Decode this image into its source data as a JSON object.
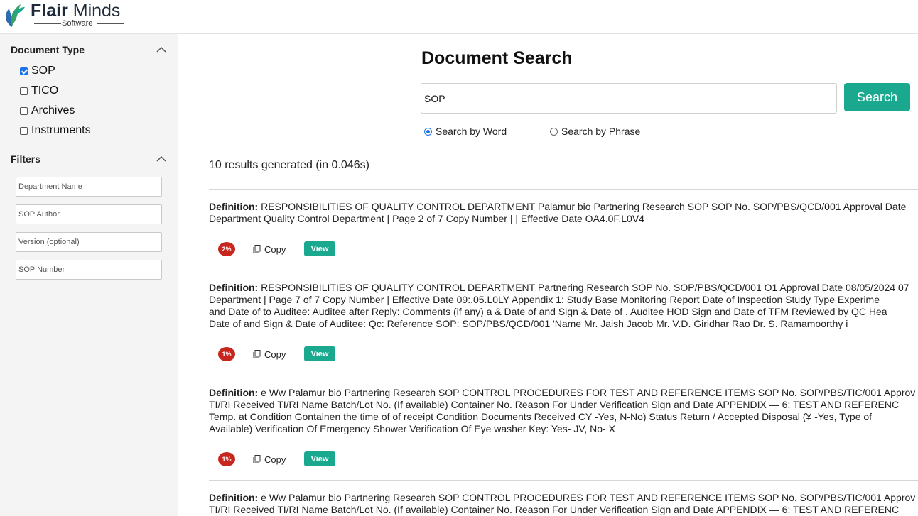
{
  "brand": {
    "name_bold": "Flair",
    "name_rest": " Minds",
    "sub": "Software"
  },
  "sidebar": {
    "document_type_title": "Document Type",
    "document_types": [
      {
        "label": "SOP",
        "checked": true
      },
      {
        "label": "TICO",
        "checked": false
      },
      {
        "label": "Archives",
        "checked": false
      },
      {
        "label": "Instruments",
        "checked": false
      }
    ],
    "filters_title": "Filters",
    "filters": [
      {
        "placeholder": "Department Name"
      },
      {
        "placeholder": "SOP Author"
      },
      {
        "placeholder": "Version (optional)"
      },
      {
        "placeholder": "SOP Number"
      }
    ]
  },
  "main": {
    "title": "Document Search",
    "search_value": "SOP",
    "search_button": "Search",
    "radio_word": "Search by Word",
    "radio_phrase": "Search by Phrase",
    "selected_mode": "word",
    "results_summary": "10 results generated (in 0.046s)"
  },
  "results": [
    {
      "definition_label": "Definition:",
      "lines": [
        " RESPONSIBILITIES OF QUALITY CONTROL DEPARTMENT Palamur bio Partnering Research SOP SOP No. SOP/PBS/QCD/001 Approval Date",
        "Department Quality Control Department | Page 2 of 7 Copy Number | | Effective Date OA4.0F.L0V4"
      ],
      "score": "2%",
      "copy": "Copy",
      "view": "View"
    },
    {
      "definition_label": "Definition:",
      "lines": [
        " RESPONSIBILITIES OF QUALITY CONTROL DEPARTMENT Partnering Research SOP No. SOP/PBS/QCD/001 O1 Approval Date 08/05/2024 07",
        "Department | Page 7 of 7 Copy Number | Effective Date 09:.05.L0LY Appendix 1: Study Base Monitoring Report Date of Inspection Study Type Experime",
        "and Date of to Auditee: Auditee after Reply: Comments (if any) a & Date of and Sign & Date of . Auditee HOD Sign and Date of TFM Reviewed by QC Hea",
        "Date of and Sign & Date of Auditee: Qc: Reference SOP: SOP/PBS/QCD/001 'Name Mr. Jaish Jacob Mr. V.D. Giridhar Rao Dr. S. Ramamoorthy i"
      ],
      "score": "1%",
      "copy": "Copy",
      "view": "View"
    },
    {
      "definition_label": "Definition:",
      "lines": [
        " e Ww Palamur bio Partnering Research SOP CONTROL PROCEDURES FOR TEST AND REFERENCE ITEMS SOP No. SOP/PBS/TIC/001 Approv",
        "TI/RI Received TI/RI Name Batch/Lot No. (If available) Container No. Reason For Under Verification Sign and Date APPENDIX — 6: TEST AND REFERENC",
        "Temp. at Condition Gontainen the time of of receipt Condition Documents Received CY -Yes, N-No) Status Return / Accepted Disposal (¥ -Yes, Type of",
        "Available) Verification Of Emergency Shower Verification Of Eye washer Key: Yes- JV, No- X"
      ],
      "score": "1%",
      "copy": "Copy",
      "view": "View"
    },
    {
      "definition_label": "Definition:",
      "lines": [
        " e Ww Palamur bio Partnering Research SOP CONTROL PROCEDURES FOR TEST AND REFERENCE ITEMS SOP No. SOP/PBS/TIC/001 Approv",
        "TI/RI Received TI/RI Name Batch/Lot No. (If available) Container No. Reason For Under Verification Sign and Date APPENDIX — 6: TEST AND REFERENC"
      ]
    }
  ]
}
